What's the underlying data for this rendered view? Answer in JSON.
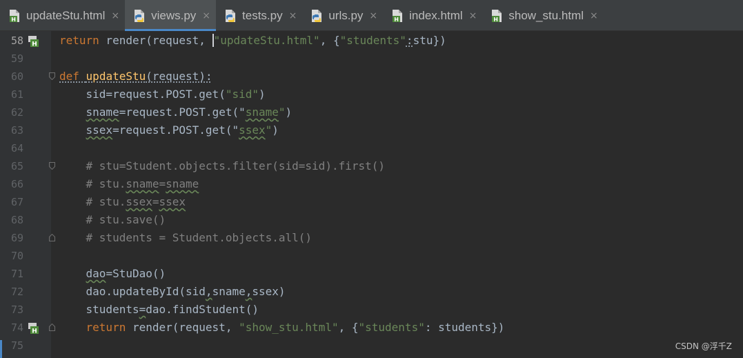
{
  "tabs": [
    {
      "label": "updateStu.html",
      "icon": "html-file-icon",
      "active": false
    },
    {
      "label": "views.py",
      "icon": "python-file-icon",
      "active": true
    },
    {
      "label": "tests.py",
      "icon": "python-file-icon",
      "active": false
    },
    {
      "label": "urls.py",
      "icon": "python-file-icon",
      "active": false
    },
    {
      "label": "index.html",
      "icon": "html-file-icon",
      "active": false
    },
    {
      "label": "show_stu.html",
      "icon": "html-file-icon",
      "active": false
    }
  ],
  "tab_close_glyph": "×",
  "editor": {
    "lines": [
      {
        "number": "58",
        "tokens": [
          {
            "t": "return",
            "c": "kw"
          },
          {
            "t": " render(request, "
          },
          {
            "t": "|",
            "c": "caret"
          },
          {
            "t": "\"updateStu.html\"",
            "c": "str"
          },
          {
            "t": ", {"
          },
          {
            "t": "\"students\"",
            "c": "str"
          },
          {
            "t": ":",
            "c": "dott"
          },
          {
            "t": "stu})"
          }
        ]
      },
      {
        "number": "59",
        "tokens": []
      },
      {
        "number": "60",
        "tokens": [
          {
            "t": "def",
            "c": "kw dott"
          },
          {
            "t": " ",
            "c": "dott"
          },
          {
            "t": "updateStu",
            "c": "fn dott"
          },
          {
            "t": "(request):",
            "c": "dott"
          }
        ]
      },
      {
        "number": "61",
        "tokens": [
          {
            "t": "    sid=request.POST.get("
          },
          {
            "t": "\"sid\"",
            "c": "str"
          },
          {
            "t": ")"
          }
        ]
      },
      {
        "number": "62",
        "tokens": [
          {
            "t": "    "
          },
          {
            "t": "sname",
            "c": "wv"
          },
          {
            "t": "=request.POST.get("
          },
          {
            "t": "\""
          },
          {
            "t": "sname",
            "c": "str wv"
          },
          {
            "t": "\"",
            "c": "str"
          },
          {
            "t": ")"
          }
        ]
      },
      {
        "number": "63",
        "tokens": [
          {
            "t": "    "
          },
          {
            "t": "ssex",
            "c": "wv"
          },
          {
            "t": "=request.POST.get("
          },
          {
            "t": "\""
          },
          {
            "t": "ssex",
            "c": "str wv"
          },
          {
            "t": "\"",
            "c": "str"
          },
          {
            "t": ")"
          }
        ]
      },
      {
        "number": "64",
        "tokens": []
      },
      {
        "number": "65",
        "tokens": [
          {
            "t": "    # stu=Student.objects.filter(sid=sid).first()",
            "c": "cm"
          }
        ]
      },
      {
        "number": "66",
        "tokens": [
          {
            "t": "    # stu.",
            "c": "cm"
          },
          {
            "t": "sname",
            "c": "cm wv"
          },
          {
            "t": "=",
            "c": "cm"
          },
          {
            "t": "sname",
            "c": "cm wv"
          }
        ]
      },
      {
        "number": "67",
        "tokens": [
          {
            "t": "    # stu.",
            "c": "cm"
          },
          {
            "t": "ssex",
            "c": "cm wv"
          },
          {
            "t": "=",
            "c": "cm"
          },
          {
            "t": "ssex",
            "c": "cm wv"
          }
        ]
      },
      {
        "number": "68",
        "tokens": [
          {
            "t": "    # stu.save()",
            "c": "cm"
          }
        ]
      },
      {
        "number": "69",
        "tokens": [
          {
            "t": "    # students = Student.objects.all()",
            "c": "cm"
          }
        ]
      },
      {
        "number": "70",
        "tokens": []
      },
      {
        "number": "71",
        "tokens": [
          {
            "t": "    "
          },
          {
            "t": "dao",
            "c": "wv"
          },
          {
            "t": "=StuDao()"
          }
        ]
      },
      {
        "number": "72",
        "tokens": [
          {
            "t": "    dao.updateById(sid"
          },
          {
            "t": ",",
            "c": "wv"
          },
          {
            "t": "sname"
          },
          {
            "t": ",",
            "c": "wv"
          },
          {
            "t": "ssex)"
          }
        ]
      },
      {
        "number": "73",
        "tokens": [
          {
            "t": "    students"
          },
          {
            "t": "=",
            "c": "wv"
          },
          {
            "t": "dao.findStudent()"
          }
        ]
      },
      {
        "number": "74",
        "tokens": [
          {
            "t": "    "
          },
          {
            "t": "return",
            "c": "kw"
          },
          {
            "t": " render(request, "
          },
          {
            "t": "\"show_stu.html\"",
            "c": "str"
          },
          {
            "t": ", {"
          },
          {
            "t": "\"students\"",
            "c": "str"
          },
          {
            "t": ": students})"
          }
        ]
      },
      {
        "number": "75",
        "tokens": []
      }
    ],
    "gutter_icons": {
      "58": "html-template-icon",
      "74": "html-template-icon"
    },
    "fold_markers": {
      "60": "fold-start",
      "65": "fold-start",
      "69": "fold-end",
      "74": "fold-end"
    }
  },
  "watermark": "CSDN @浮千Z",
  "colors": {
    "background": "#2b2b2b",
    "gutter": "#313335",
    "tab_bar": "#3c3f41",
    "active_tab_underline": "#4a88c7",
    "keyword": "#cc7832",
    "function_name": "#ffc66d",
    "string": "#6a8759",
    "comment": "#808080",
    "plain_text": "#a9b7c6"
  }
}
